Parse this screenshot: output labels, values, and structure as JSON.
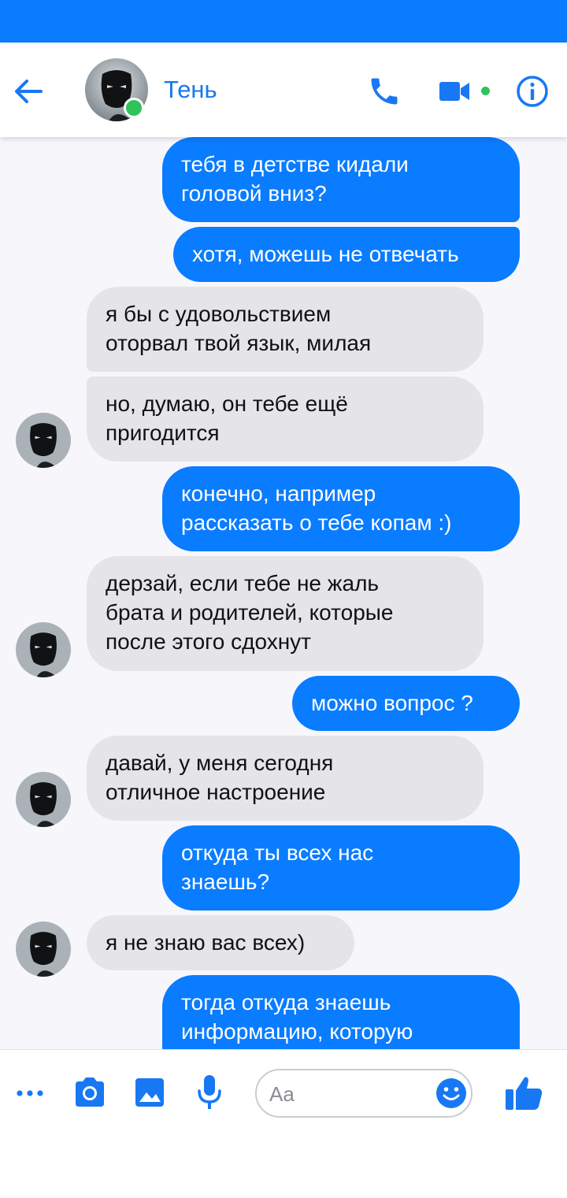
{
  "colors": {
    "accent": "#0a7cff",
    "online": "#2fc35b",
    "incoming_bubble": "#e4e4e9"
  },
  "header": {
    "contact_name": "Тень",
    "icons": [
      "back-arrow-icon",
      "phone-icon",
      "video-camera-icon",
      "info-icon"
    ]
  },
  "messages": [
    {
      "side": "out",
      "text": "тебя в детстве кидали\nголовой вниз?"
    },
    {
      "side": "out",
      "text": "хотя, можешь не отвечать"
    },
    {
      "side": "in",
      "text": "я бы с удовольствием\nоторвал твой язык, милая"
    },
    {
      "side": "in",
      "text": "но, думаю, он тебе ещё\nпригодится"
    },
    {
      "side": "out",
      "text": "конечно, например\nрассказать о тебе копам :)"
    },
    {
      "side": "in",
      "text": "дерзай, если тебе не жаль\nбрата и родителей, которые\nпосле этого сдохнут"
    },
    {
      "side": "out",
      "text": "можно вопрос ?"
    },
    {
      "side": "in",
      "text": "давай, у меня сегодня\nотличное настроение"
    },
    {
      "side": "out",
      "text": "откуда ты всех нас\nзнаешь?"
    },
    {
      "side": "in",
      "text": "я не знаю вас всех)"
    },
    {
      "side": "out",
      "text": "тогда откуда знаешь\nинформацию, которую"
    }
  ],
  "composer": {
    "placeholder": "Aa",
    "icons": [
      "more-icon",
      "camera-icon",
      "gallery-icon",
      "microphone-icon",
      "emoji-icon",
      "like-icon"
    ]
  }
}
